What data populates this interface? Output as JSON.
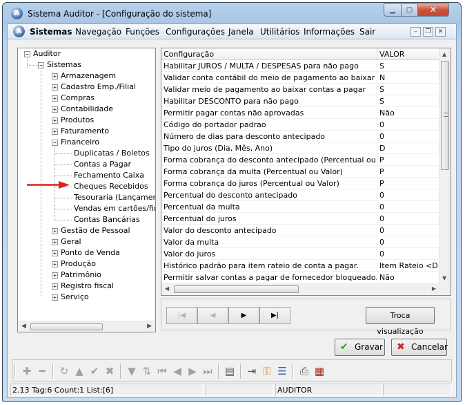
{
  "window": {
    "title": "Sistema Auditor - [Configuração do sistema]",
    "app_icon_glyph": "A",
    "controls": [
      "minimize",
      "maximize",
      "close"
    ]
  },
  "menubar": {
    "items": [
      "Sistemas",
      "Navegação",
      "Funções",
      "Configurações",
      "Janela",
      "Utilitários",
      "Informações",
      "Sair"
    ],
    "active": "Sistemas"
  },
  "tree": {
    "root": "Auditor",
    "sistemas": "Sistemas",
    "nodes": [
      "Armazenagem",
      "Cadastro Emp./Filial",
      "Compras",
      "Contabilidade",
      "Produtos",
      "Faturamento",
      "Financeiro"
    ],
    "financeiro_children": [
      "Duplicatas / Boletos",
      "Contas a Pagar",
      "Fechamento Caixa",
      "Cheques Recebidos",
      "Tesouraria (Lançamentos",
      "Vendas em cartões/finar",
      "Contas Bancárias"
    ],
    "nodes_after": [
      "Gestão de Pessoal",
      "Geral",
      "Ponto de Venda",
      "Produção",
      "Patrimônio",
      "Registro fiscal",
      "Serviço"
    ],
    "selected": "Contas a Pagar"
  },
  "grid": {
    "headers": [
      "Configuração",
      "VALOR"
    ],
    "rows": [
      [
        "Habilitar JUROS / MULTA / DESPESAS para não pago",
        "S"
      ],
      [
        "Validar conta contábil do meio de pagamento ao baixar contas a p",
        "N"
      ],
      [
        "Validar meio de pagamento ao baixar contas a pagar",
        "S"
      ],
      [
        "Habilitar DESCONTO para não pago",
        "S"
      ],
      [
        "Permitir pagar contas não aprovadas",
        "Não"
      ],
      [
        "Código do portador padrao",
        "0"
      ],
      [
        "Número de dias para desconto antecipado",
        "0"
      ],
      [
        "Tipo do juros (Dia, Mês, Ano)",
        "D"
      ],
      [
        "Forma cobrança do desconto antecipado (Percentual ou Valor)",
        "P"
      ],
      [
        "Forma cobrança da multa (Percentual ou Valor)",
        "P"
      ],
      [
        "Forma cobrança do juros (Percentual ou Valor)",
        "P"
      ],
      [
        "Percentual do desconto antecipado",
        "0"
      ],
      [
        "Percentual da multa",
        "0"
      ],
      [
        "Percentual do juros",
        "0"
      ],
      [
        "Valor do desconto antecipado",
        "0"
      ],
      [
        "Valor da multa",
        "0"
      ],
      [
        "Valor do juros",
        "0"
      ],
      [
        "Histórico padrão para item rateio de conta a pagar.",
        "Item Rateio <D>"
      ],
      [
        "Permitir salvar contas a pagar de fornecedor bloqueado.",
        "Não"
      ]
    ]
  },
  "nav": {
    "first": "|◀",
    "prev": "◀",
    "next": "▶",
    "last": "▶|",
    "troca_label": "Troca visualização"
  },
  "actions": {
    "gravar_label": "Gravar",
    "cancelar_label": "Cancelar"
  },
  "status": {
    "left": "2.13 Tag:6 Count:1 List:[6]",
    "middle": "",
    "user": "AUDITOR",
    "right": ""
  },
  "colors": {
    "selection_arrow": "#e0201a",
    "gravar_icon": "#2a9a2a",
    "cancelar_icon": "#d02020"
  }
}
